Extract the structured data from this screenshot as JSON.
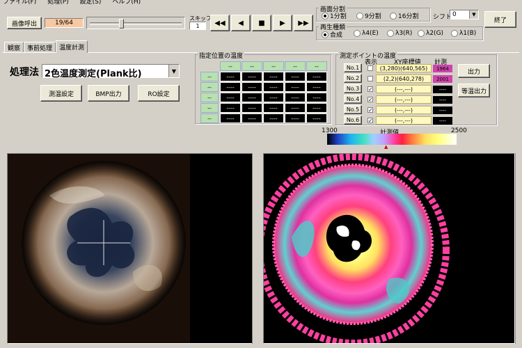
{
  "menu": [
    "ファイル(F)",
    "処理(P)",
    "設定(S)",
    "ヘルプ(H)"
  ],
  "toolbar": {
    "load_button": "画像呼出",
    "frame_counter": "19/64",
    "skip_label": "スキップ",
    "skip_value": "1",
    "playback_buttons": [
      "◀◀",
      "◀",
      "■",
      "▶",
      "▶▶"
    ],
    "exit_button": "終了"
  },
  "screen_split": {
    "label": "画面分割",
    "options": [
      {
        "label": "1分割",
        "selected": true
      },
      {
        "label": "9分割",
        "selected": false
      },
      {
        "label": "16分割",
        "selected": false
      }
    ],
    "shift_label": "シフト",
    "shift_value": "0"
  },
  "playback_type": {
    "label": "再生種類",
    "options": [
      {
        "label": "合成",
        "selected": true
      },
      {
        "label": "λ4(E)",
        "selected": false
      },
      {
        "label": "λ3(R)",
        "selected": false
      },
      {
        "label": "λ2(G)",
        "selected": false
      },
      {
        "label": "λ1(B)",
        "selected": false
      }
    ]
  },
  "tabs": [
    {
      "label": "観察",
      "active": false
    },
    {
      "label": "事前処理",
      "active": false
    },
    {
      "label": "温度計測",
      "active": true
    }
  ],
  "method": {
    "label": "処理法",
    "value": "2色温度測定(Plank比)"
  },
  "action_buttons": {
    "measure_settings": "測温設定",
    "bmp_output": "BMP出力",
    "ro_settings": "RO設定"
  },
  "position_temps": {
    "label": "指定位置の温度",
    "placeholder": "----",
    "col_header": "--",
    "row_header": "--",
    "cols": 5,
    "rows": 5
  },
  "measure_points": {
    "label": "測定ポイントの温度",
    "header_show": "表示",
    "header_xy": "XY座標値",
    "header_meas": "計測",
    "points": [
      {
        "name": "No.1",
        "show": false,
        "xy": "(3,280)(640,565)",
        "value": "1964",
        "highlight": true
      },
      {
        "name": "No.2",
        "show": false,
        "xy": "(2,2)(640,278)",
        "value": "2001",
        "highlight": true
      },
      {
        "name": "No.3",
        "show": true,
        "xy": "(---,---)",
        "value": "----",
        "highlight": false
      },
      {
        "name": "No.4",
        "show": true,
        "xy": "(---,---)",
        "value": "----",
        "highlight": false
      },
      {
        "name": "No.5",
        "show": true,
        "xy": "(---,---)",
        "value": "----",
        "highlight": false
      },
      {
        "name": "No.6",
        "show": true,
        "xy": "(---,---)",
        "value": "----",
        "highlight": false
      }
    ],
    "output_button": "出力",
    "isotherm_button": "等温出力"
  },
  "colorbar": {
    "min": "1300",
    "max": "2500",
    "label": "計測値"
  }
}
